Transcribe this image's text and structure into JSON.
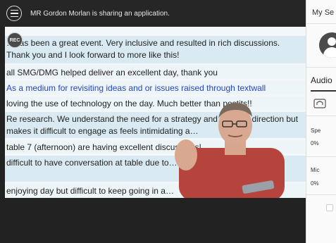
{
  "share_bar": {
    "message": "MR Gordon Morlan is sharing an application."
  },
  "shared_app": {
    "rows": [
      {
        "text": "…has been a great event. Very inclusive and resulted in rich discussions. Thank you and I look forward to more like this!",
        "style": "a"
      },
      {
        "text": "all SMG/DMG helped deliver an excellent day, thank you",
        "style": "b"
      },
      {
        "text": "As a medium for revisiting ideas and or issues raised through textwall",
        "style": "blue"
      },
      {
        "text": "loving the use of technology on the day. Much better than postits!!",
        "style": "b"
      },
      {
        "text": "Re research. We understand the need for a strategy and focused direction but makes it difficult to engage as feels intimidating a…",
        "style": "a"
      },
      {
        "text": "table 7 (afternoon) are having excellent discussions!",
        "style": "b"
      },
      {
        "text": "difficult to have conversation at table due to… difficult to hear people",
        "style": "a"
      },
      {
        "text": "enjoying day but difficult to keep going in a…",
        "style": "b"
      }
    ]
  },
  "record_icon": {
    "label": "REC"
  },
  "panel": {
    "title": "My Se",
    "audio_title": "Audio",
    "speaker_label": "Spe",
    "speaker_value": "0%",
    "mic_label": "Mic",
    "mic_value": "0%"
  },
  "colors": {
    "row_a": "#d9eaf3",
    "row_b": "#eef5f9",
    "link_blue": "#2244cc",
    "bar_bg": "#262626"
  }
}
